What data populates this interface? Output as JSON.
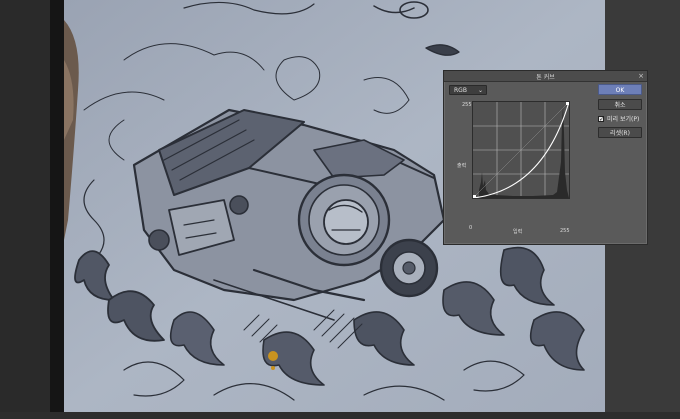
{
  "dialog": {
    "title": "톤 커브",
    "close_glyph": "×",
    "channel": {
      "selected": "RGB",
      "caret": "⌄"
    },
    "graph": {
      "label_top_left": "255",
      "label_output": "출력",
      "label_input": "입력",
      "label_bottom_left": "0",
      "label_bottom_right": "255",
      "curve_points": [
        [
          0,
          0
        ],
        [
          255,
          255
        ]
      ]
    },
    "buttons": {
      "ok": "OK",
      "cancel": "취소",
      "preview_label": "미리 보기(P)",
      "preview_checked": true,
      "reset": "리셋(R)"
    }
  },
  "colors": {
    "ok_button": "#6d7fb8",
    "canvas_paper": "#a7b0bf",
    "ui_dark": "#3d3d3d"
  }
}
